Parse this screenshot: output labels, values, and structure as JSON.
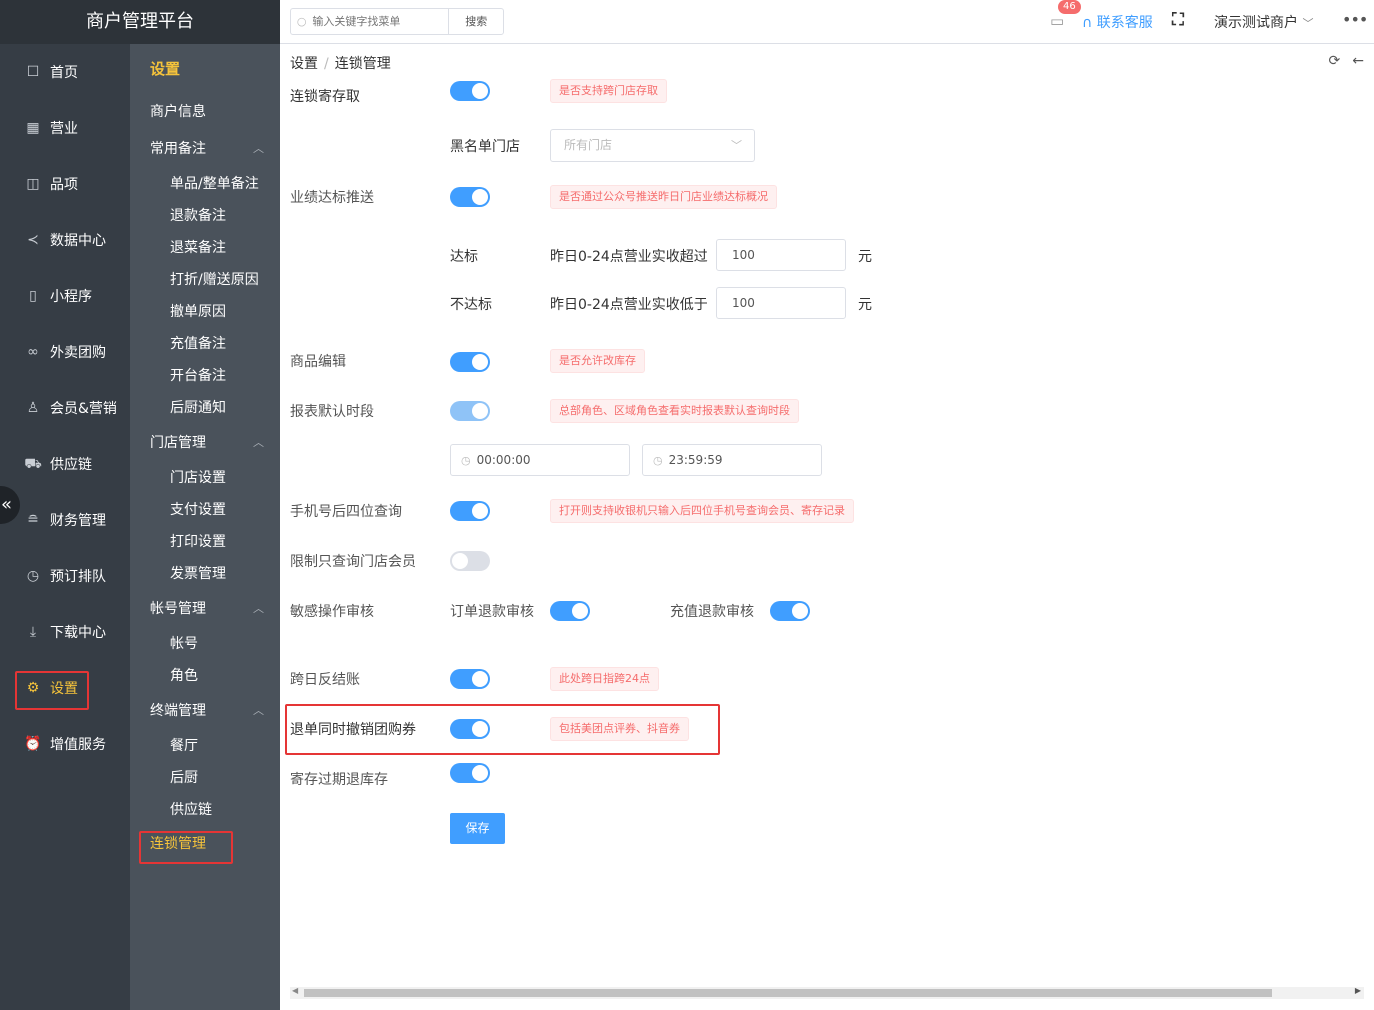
{
  "app_title": "商户管理平台",
  "nav": [
    {
      "label": "首页",
      "icon": "note-icon"
    },
    {
      "label": "营业",
      "icon": "calendar-icon"
    },
    {
      "label": "品项",
      "icon": "bag-icon"
    },
    {
      "label": "数据中心",
      "icon": "share-icon"
    },
    {
      "label": "小程序",
      "icon": "tablet-icon"
    },
    {
      "label": "外卖团购",
      "icon": "bike-icon"
    },
    {
      "label": "会员&营销",
      "icon": "user-icon"
    },
    {
      "label": "供应链",
      "icon": "truck-icon"
    },
    {
      "label": "财务管理",
      "icon": "database-icon"
    },
    {
      "label": "预订排队",
      "icon": "clock-icon"
    },
    {
      "label": "下载中心",
      "icon": "download-icon"
    },
    {
      "label": "设置",
      "icon": "gear-icon"
    },
    {
      "label": "增值服务",
      "icon": "alarm-icon"
    }
  ],
  "submenu": {
    "title": "设置",
    "merchant_info": "商户信息",
    "group1": {
      "label": "常用备注",
      "items": [
        "单品/整单备注",
        "退款备注",
        "退菜备注",
        "打折/赠送原因",
        "撤单原因",
        "充值备注",
        "开台备注",
        "后厨通知"
      ]
    },
    "group2": {
      "label": "门店管理",
      "items": [
        "门店设置",
        "支付设置",
        "打印设置",
        "发票管理"
      ]
    },
    "group3": {
      "label": "帐号管理",
      "items": [
        "帐号",
        "角色"
      ]
    },
    "group4": {
      "label": "终端管理",
      "items": [
        "餐厅",
        "后厨",
        "供应链"
      ]
    },
    "active": "连锁管理"
  },
  "topbar": {
    "search_placeholder": "输入关键字找菜单",
    "search_button": "搜索",
    "badge": "46",
    "service": "联系客服",
    "merchant": "演示测试商户"
  },
  "breadcrumb": {
    "parent": "设置",
    "current": "连锁管理"
  },
  "form": {
    "chain_deposit": {
      "label": "连锁寄存取",
      "tag": "是否支持跨门店存取"
    },
    "blacklist": {
      "label": "黑名单门店",
      "placeholder": "所有门店"
    },
    "perf_push": {
      "label": "业绩达标推送",
      "tag": "是否通过公众号推送昨日门店业绩达标概况"
    },
    "reach": {
      "label": "达标",
      "desc": "昨日0-24点营业实收超过",
      "value": "100",
      "unit": "元"
    },
    "not_reach": {
      "label": "不达标",
      "desc": "昨日0-24点营业实收低于",
      "value": "100",
      "unit": "元"
    },
    "goods_edit": {
      "label": "商品编辑",
      "tag": "是否允许改库存"
    },
    "report_period": {
      "label": "报表默认时段",
      "tag": "总部角色、区域角色查看实时报表默认查询时段",
      "start": "00:00:00",
      "end": "23:59:59"
    },
    "phone_last4": {
      "label": "手机号后四位查询",
      "tag": "打开则支持收银机只输入后四位手机号查询会员、寄存记录"
    },
    "store_member": {
      "label": "限制只查询门店会员"
    },
    "sensitive": {
      "label": "敏感操作审核",
      "order_refund": "订单退款审核",
      "recharge_refund": "充值退款审核"
    },
    "cross_day": {
      "label": "跨日反结账",
      "tag": "此处跨日指跨24点"
    },
    "refund_coupon": {
      "label": "退单同时撤销团购券",
      "tag": "包括美团点评券、抖音券"
    },
    "deposit_expire": {
      "label": "寄存过期退库存"
    },
    "save": "保存"
  }
}
